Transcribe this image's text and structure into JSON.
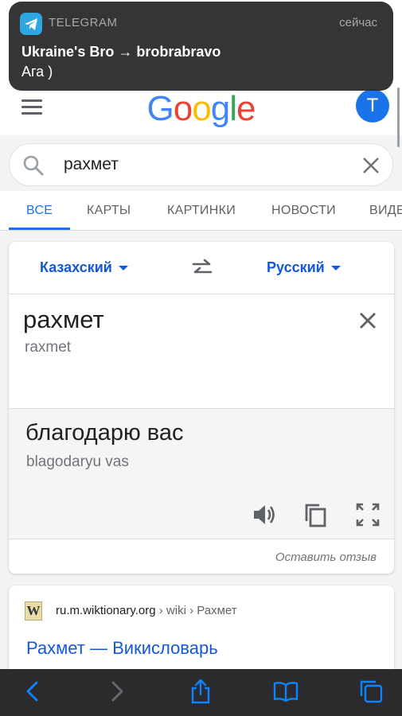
{
  "notification": {
    "app": "TELEGRAM",
    "time": "сейчас",
    "title": "Ukraine's Bro → brobrabravo",
    "body": "Ага )"
  },
  "header": {
    "logo_letters": [
      "G",
      "o",
      "o",
      "g",
      "l",
      "e"
    ],
    "logo_colors": [
      "#4285F4",
      "#EA4335",
      "#FBBC05",
      "#4285F4",
      "#34A853",
      "#EA4335"
    ],
    "avatar_letter": "T"
  },
  "search": {
    "query": "рахмет"
  },
  "tabs": [
    {
      "label": "ВСЕ",
      "active": true
    },
    {
      "label": "КАРТЫ",
      "active": false
    },
    {
      "label": "КАРТИНКИ",
      "active": false
    },
    {
      "label": "НОВОСТИ",
      "active": false
    },
    {
      "label": "ВИДЕО",
      "active": false
    }
  ],
  "translate": {
    "source_lang": "Казахский",
    "target_lang": "Русский",
    "source_text": "рахмет",
    "source_translit": "raxmet",
    "target_text": "благодарю вас",
    "target_translit": "blagodaryu vas",
    "feedback": "Оставить отзыв"
  },
  "result": {
    "domain": "ru.m.wiktionary.org",
    "path": " › wiki › Рахмет",
    "title": "Рахмет — Викисловарь"
  },
  "colors": {
    "accent": "#1a73e8",
    "link": "#1558d6",
    "telegram": "#2ea6e0",
    "toolbar_icon": "#0a84ff"
  }
}
